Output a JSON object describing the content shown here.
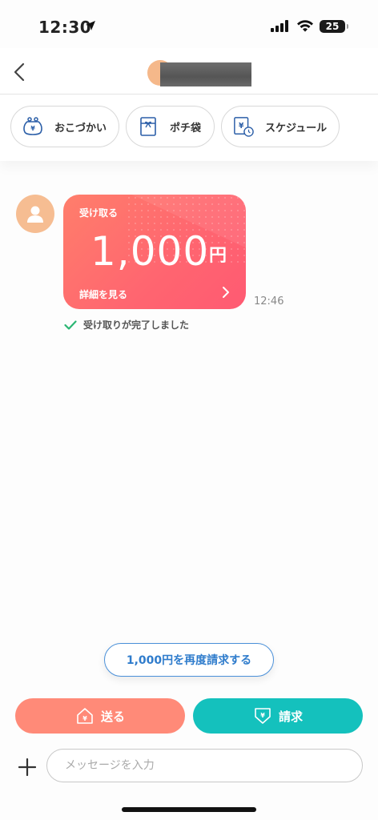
{
  "status_bar": {
    "time": "12:30",
    "battery": "25"
  },
  "quick_actions": [
    {
      "label": "おこづかい",
      "icon": "coin-purse-icon"
    },
    {
      "label": "ポチ袋",
      "icon": "gift-envelope-icon"
    },
    {
      "label": "スケジュール",
      "icon": "yen-schedule-icon"
    }
  ],
  "message": {
    "card_label": "受け取る",
    "amount": "1,000",
    "currency": "円",
    "detail_link": "詳細を見る",
    "time": "12:46",
    "status_text": "受け取りが完了しました"
  },
  "rerequest_label": "1,000円を再度請求する",
  "actions": {
    "send_label": "送る",
    "request_label": "請求"
  },
  "composer": {
    "placeholder": "メッセージを入力"
  },
  "colors": {
    "send": "#ff8a78",
    "request": "#14c1bd",
    "accent_blue": "#2f7ccc",
    "card": "#ff6570",
    "check": "#2bb673"
  }
}
